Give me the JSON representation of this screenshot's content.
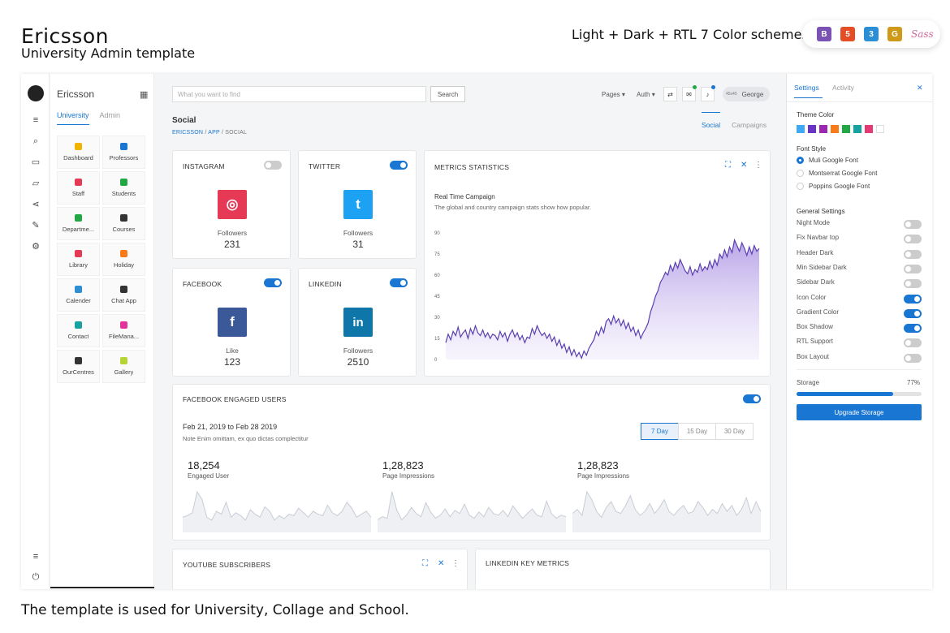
{
  "page": {
    "title": "Ericsson",
    "subtitle": "University Admin template",
    "tagline": "Light + Dark + RTL 7 Color schemes",
    "footer": "The template is used for University, Collage and School.",
    "badges": [
      {
        "label": "B",
        "icon": "bootstrap-icon",
        "color": "#7952b3"
      },
      {
        "label": "5",
        "icon": "html5-icon",
        "color": "#e44d26"
      },
      {
        "label": "3",
        "icon": "css3-icon",
        "color": "#2c8fd6"
      },
      {
        "label": "G",
        "icon": "gulp-icon",
        "color": "#cf9a1a"
      },
      {
        "label": "Sass",
        "icon": "sass-icon",
        "color": "#d0679a"
      }
    ]
  },
  "sidebar": {
    "brand": "Ericsson",
    "tabs": [
      "University",
      "Admin"
    ],
    "rail_icons": [
      "menu-icon",
      "search-icon",
      "inbox-icon",
      "folder-icon",
      "share-icon",
      "pen-icon",
      "gear-icon",
      "list-icon",
      "power-icon"
    ],
    "apps": [
      {
        "label": "Dashboard",
        "icon": "dashboard-icon",
        "color": "#f2b400"
      },
      {
        "label": "Professors",
        "icon": "id-card-icon",
        "color": "#1976d2"
      },
      {
        "label": "Staff",
        "icon": "user-icon",
        "color": "#e53955"
      },
      {
        "label": "Students",
        "icon": "users-icon",
        "color": "#22a745"
      },
      {
        "label": "Departme...",
        "icon": "department-icon",
        "color": "#22a745"
      },
      {
        "label": "Courses",
        "icon": "graduation-cap-icon",
        "color": "#333333"
      },
      {
        "label": "Library",
        "icon": "book-icon",
        "color": "#e53955"
      },
      {
        "label": "Holiday",
        "icon": "bullhorn-icon",
        "color": "#f97b17"
      },
      {
        "label": "Calender",
        "icon": "calendar-icon",
        "color": "#2c8fd6"
      },
      {
        "label": "Chat App",
        "icon": "chat-icon",
        "color": "#333333"
      },
      {
        "label": "Contact",
        "icon": "contact-icon",
        "color": "#17a2a2"
      },
      {
        "label": "FileMana...",
        "icon": "folder-icon",
        "color": "#e3339a"
      },
      {
        "label": "OurCentres",
        "icon": "map-icon",
        "color": "#333333"
      },
      {
        "label": "Gallery",
        "icon": "image-icon",
        "color": "#b6d534"
      }
    ]
  },
  "topbar": {
    "search_placeholder": "What you want to find",
    "search_button": "Search",
    "menus": [
      "Pages",
      "Auth"
    ],
    "user": "George",
    "avatar_text": "45x45"
  },
  "page_header": {
    "title": "Social",
    "breadcrumb": [
      "ERICSSON",
      "APP",
      "SOCIAL"
    ],
    "tabs": [
      "Social",
      "Campaigns"
    ]
  },
  "social_cards": [
    {
      "title": "INSTAGRAM",
      "label": "Followers",
      "value": "231",
      "enabled": false,
      "color": "#e53955",
      "glyph": "◎",
      "icon": "instagram-icon"
    },
    {
      "title": "TWITTER",
      "label": "Followers",
      "value": "31",
      "enabled": true,
      "color": "#1da1f2",
      "glyph": "t",
      "icon": "twitter-icon"
    },
    {
      "title": "FACEBOOK",
      "label": "Like",
      "value": "123",
      "enabled": true,
      "color": "#3b5998",
      "glyph": "f",
      "icon": "facebook-icon"
    },
    {
      "title": "LINKEDIN",
      "label": "Followers",
      "value": "2510",
      "enabled": true,
      "color": "#0e76a8",
      "glyph": "in",
      "icon": "linkedin-icon"
    }
  ],
  "metrics": {
    "title": "METRICS STATISTICS",
    "campaign_title": "Real Time Campaign",
    "campaign_desc": "The global and country campaign stats show how popular."
  },
  "chart_data": {
    "type": "area",
    "ylim": [
      0,
      90
    ],
    "yticks": [
      0,
      15,
      30,
      45,
      60,
      75,
      90
    ],
    "series": [
      {
        "values": [
          12,
          18,
          14,
          20,
          17,
          23,
          16,
          19,
          21,
          15,
          22,
          18,
          24,
          19,
          17,
          21,
          16,
          19,
          15,
          18,
          17,
          14,
          20,
          16,
          19,
          13,
          18,
          21,
          16,
          19,
          14,
          17,
          12,
          16,
          15,
          22,
          18,
          24,
          20,
          17,
          19,
          15,
          18,
          13,
          16,
          10,
          14,
          8,
          11,
          5,
          9,
          3,
          7,
          2,
          5,
          1,
          6,
          3,
          8,
          11,
          14,
          20,
          17,
          23,
          19,
          27,
          29,
          25,
          31,
          26,
          29,
          24,
          28,
          22,
          26,
          20,
          23,
          17,
          21,
          15,
          19,
          22,
          26,
          34,
          39,
          45,
          49,
          55,
          58,
          62,
          60,
          67,
          63,
          69,
          65,
          71,
          67,
          63,
          61,
          66,
          60,
          64,
          62,
          68,
          63,
          66,
          64,
          70,
          65,
          71,
          67,
          75,
          72,
          78,
          73,
          80,
          76,
          85,
          81,
          77,
          83,
          79,
          74,
          80,
          75,
          81,
          77,
          79
        ]
      }
    ]
  },
  "engaged": {
    "title": "FACEBOOK ENGAGED USERS",
    "date_range": "Feb 21, 2019 to Feb 28 2019",
    "note": "Note Enim omittam, ex quo dictas complectitur",
    "ranges": [
      "7 Day",
      "15 Day",
      "30 Day"
    ],
    "active_range": "7 Day",
    "stats": [
      {
        "value": "18,254",
        "label": "Engaged User"
      },
      {
        "value": "1,28,823",
        "label": "Page Impressions"
      },
      {
        "value": "1,28,823",
        "label": "Page Impressions"
      }
    ],
    "sparklines": [
      [
        8,
        9,
        11,
        25,
        20,
        8,
        6,
        12,
        10,
        18,
        8,
        11,
        9,
        6,
        13,
        10,
        8,
        15,
        12,
        6,
        9,
        7,
        10,
        9,
        14,
        11,
        8,
        12,
        10,
        9,
        16,
        11,
        9,
        12,
        18,
        14,
        8,
        10,
        12,
        8
      ],
      [
        6,
        8,
        7,
        24,
        12,
        6,
        9,
        14,
        10,
        8,
        17,
        11,
        7,
        9,
        13,
        8,
        12,
        10,
        16,
        9,
        7,
        11,
        8,
        14,
        10,
        9,
        12,
        8,
        15,
        11,
        7,
        10,
        13,
        9,
        8,
        18,
        10,
        7,
        9,
        8
      ],
      [
        8,
        10,
        7,
        19,
        15,
        9,
        6,
        11,
        14,
        9,
        8,
        12,
        17,
        10,
        7,
        9,
        13,
        8,
        11,
        15,
        9,
        7,
        10,
        12,
        8,
        9,
        14,
        11,
        7,
        10,
        8,
        13,
        9,
        12,
        7,
        10,
        16,
        8,
        14,
        9
      ]
    ]
  },
  "bottom_cards": [
    "YOUTUBE SUBSCRIBERS",
    "LINKEDIN KEY METRICS"
  ],
  "settings": {
    "tabs": [
      "Settings",
      "Activity"
    ],
    "theme_color_label": "Theme Color",
    "theme_colors": [
      "#3fa9f5",
      "#6a35c6",
      "#9c27b0",
      "#f97b17",
      "#22a745",
      "#17a2a2",
      "#e53975",
      "#ffffff"
    ],
    "font_style_label": "Font Style",
    "fonts": [
      "Muli Google Font",
      "Montserrat Google Font",
      "Poppins Google Font"
    ],
    "selected_font": "Muli Google Font",
    "general_label": "General Settings",
    "toggles": [
      {
        "label": "Night Mode",
        "on": false
      },
      {
        "label": "Fix Navbar top",
        "on": false
      },
      {
        "label": "Header Dark",
        "on": false
      },
      {
        "label": "Min Sidebar Dark",
        "on": false
      },
      {
        "label": "Sidebar Dark",
        "on": false
      },
      {
        "label": "Icon Color",
        "on": true
      },
      {
        "label": "Gradient Color",
        "on": true
      },
      {
        "label": "Box Shadow",
        "on": true
      },
      {
        "label": "RTL Support",
        "on": false
      },
      {
        "label": "Box Layout",
        "on": false
      }
    ],
    "storage_label": "Storage",
    "storage_pct": "77%",
    "storage_fraction": 0.77,
    "upgrade_button": "Upgrade Storage"
  }
}
